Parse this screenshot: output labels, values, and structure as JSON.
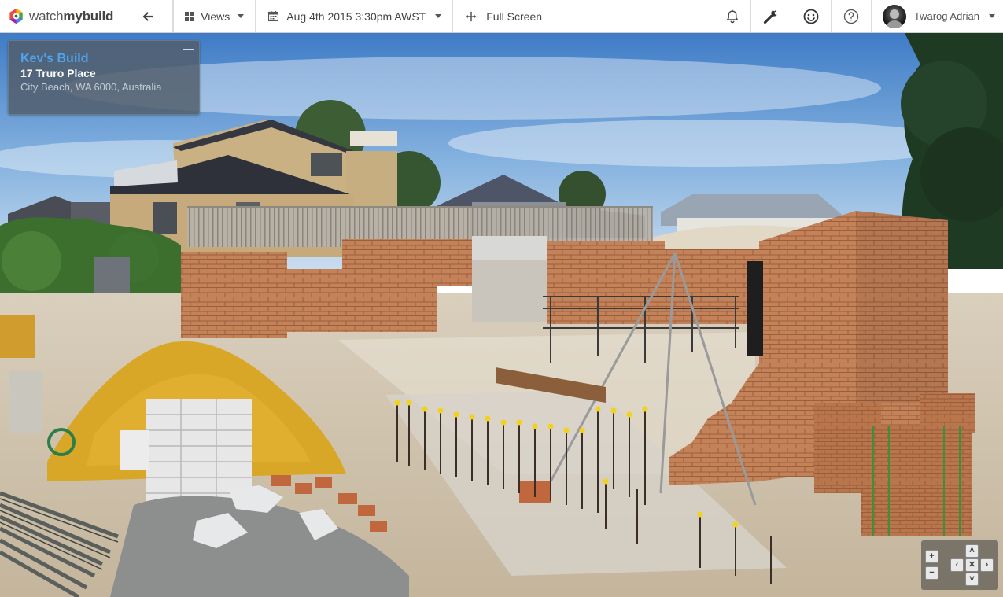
{
  "brand": {
    "name_part1": "watch",
    "name_part2": "mybuild"
  },
  "nav": {
    "views_label": "Views",
    "date_label": "Aug 4th 2015 3:30pm AWST",
    "fullscreen_label": "Full Screen"
  },
  "user": {
    "name": "Twarog Adrian"
  },
  "build": {
    "title": "Kev's Build",
    "address": "17 Truro Place",
    "city": "City Beach, WA 6000, Australia",
    "minimize_symbol": "—"
  },
  "ptz": {
    "zoom_in": "+",
    "zoom_out": "−",
    "up": "˄",
    "down": "˅",
    "left": "‹",
    "right": "›",
    "center": "✕"
  },
  "icons": {
    "back": "arrow-left-icon",
    "views": "grid-icon",
    "date": "calendar-icon",
    "fullscreen": "move-arrows-icon",
    "notifications": "bell-icon",
    "settings": "wrench-icon",
    "feedback": "smiley-icon",
    "help": "question-circle-icon"
  }
}
